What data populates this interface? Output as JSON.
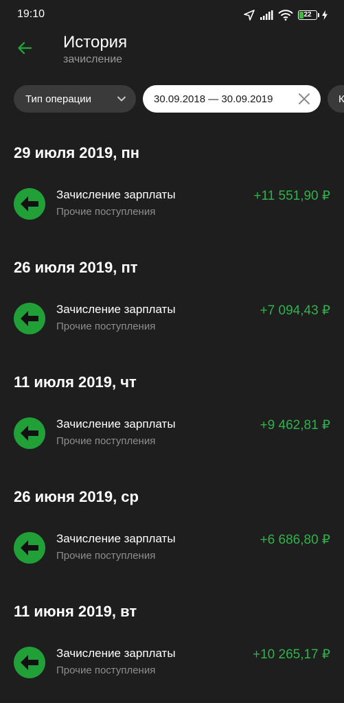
{
  "status_bar": {
    "time": "19:10",
    "battery_level": "22",
    "battery_fraction": 0.22,
    "icons": [
      "location-arrow-icon",
      "signal-icon",
      "wifi-icon",
      "battery-icon",
      "charging-bolt-icon"
    ]
  },
  "header": {
    "title": "История",
    "subtitle": "зачисление"
  },
  "filters": {
    "operation_type_label": "Тип операции",
    "date_range": "30.09.2018 — 30.09.2019",
    "more_label": "К"
  },
  "colors": {
    "background": "#1e1e1e",
    "accent_green": "#21a038",
    "amount_green": "#30b14c",
    "chip_dark": "#3a3a3a"
  },
  "days": [
    {
      "date": "29 июля 2019, пн",
      "transactions": [
        {
          "title": "Зачисление зарплаты",
          "category": "Прочие поступления",
          "amount": "+11 551,90 ₽"
        }
      ]
    },
    {
      "date": "26 июля 2019, пт",
      "transactions": [
        {
          "title": "Зачисление зарплаты",
          "category": "Прочие поступления",
          "amount": "+7 094,43 ₽"
        }
      ]
    },
    {
      "date": "11 июля 2019, чт",
      "transactions": [
        {
          "title": "Зачисление зарплаты",
          "category": "Прочие поступления",
          "amount": "+9 462,81 ₽"
        }
      ]
    },
    {
      "date": "26 июня 2019, ср",
      "transactions": [
        {
          "title": "Зачисление зарплаты",
          "category": "Прочие поступления",
          "amount": "+6 686,80 ₽"
        }
      ]
    },
    {
      "date": "11 июня 2019, вт",
      "transactions": [
        {
          "title": "Зачисление зарплаты",
          "category": "Прочие поступления",
          "amount": "+10 265,17 ₽"
        }
      ]
    }
  ]
}
